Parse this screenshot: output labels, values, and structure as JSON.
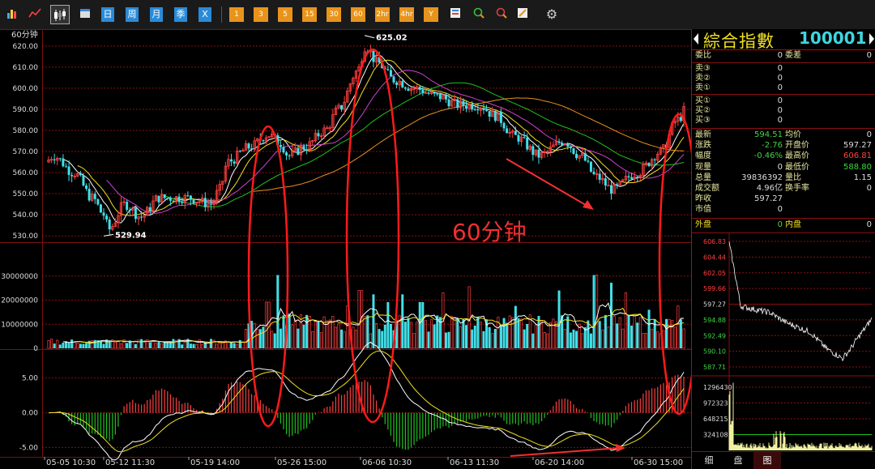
{
  "toolbar": {
    "blue_buttons": [
      {
        "label": "日",
        "name": "day-button"
      },
      {
        "label": "周",
        "name": "week-button"
      },
      {
        "label": "月",
        "name": "month-button"
      },
      {
        "label": "季",
        "name": "quarter-button"
      },
      {
        "label": "X",
        "name": "custom-period-button"
      }
    ],
    "orange_buttons": [
      {
        "label": "1",
        "name": "period-1-button"
      },
      {
        "label": "3",
        "name": "period-3-button"
      },
      {
        "label": "5",
        "name": "period-5-button"
      },
      {
        "label": "15",
        "name": "period-15-button"
      },
      {
        "label": "30",
        "name": "period-30-button"
      },
      {
        "label": "60",
        "name": "period-60-button"
      },
      {
        "label": "2hr",
        "name": "period-2hr-button"
      },
      {
        "label": "4hr",
        "name": "period-4hr-button"
      },
      {
        "label": "Y",
        "name": "year-button"
      }
    ]
  },
  "colors": {
    "up": "#ff4040",
    "down": "#40e0e8",
    "ma1": "#ffffff",
    "ma2": "#f0e020",
    "ma3": "#d040d0",
    "ma4": "#20c020",
    "ma5": "#e89020",
    "grid": "#8a1010"
  },
  "main_chart": {
    "period_label": "60分钟",
    "y_ticks": [
      "620.00",
      "610.00",
      "600.00",
      "590.00",
      "580.00",
      "570.00",
      "560.00",
      "550.00",
      "540.00",
      "530.00"
    ],
    "high_label": "625.02",
    "low_label": "529.94",
    "annotation": "60分钟"
  },
  "volume_chart": {
    "y_ticks": [
      "30000000",
      "20000000",
      "10000000",
      "0"
    ]
  },
  "macd_chart": {
    "y_ticks": [
      "5.00",
      "0.00",
      "-5.00"
    ]
  },
  "x_ticks": [
    "05-05 10:30",
    "05-12 11:30",
    "05-19 14:00",
    "05-26 15:00",
    "06-06 10:30",
    "06-13 11:30",
    "06-20 14:00",
    "06-30 15:00"
  ],
  "side": {
    "title": "綜合指數",
    "code": "100001",
    "order": {
      "wb_label": "委比",
      "wb_val": "0",
      "wc_label": "委差",
      "wc_val": "0",
      "asks": [
        {
          "label": "卖③",
          "val": "0"
        },
        {
          "label": "卖②",
          "val": "0"
        },
        {
          "label": "卖①",
          "val": "0"
        }
      ],
      "bids": [
        {
          "label": "买①",
          "val": "0"
        },
        {
          "label": "买②",
          "val": "0"
        },
        {
          "label": "买③",
          "val": "0"
        }
      ]
    },
    "quote": [
      {
        "l1": "最新",
        "v1": "594.51",
        "l2": "均价",
        "v2": "0"
      },
      {
        "l1": "涨跌",
        "v1": "-2.76",
        "l2": "开盘价",
        "v2": "597.27"
      },
      {
        "l1": "幅度",
        "v1": "-0.46%",
        "l2": "最高价",
        "v2": "606.81"
      },
      {
        "l1": "现量",
        "v1": "0",
        "l2": "最低价",
        "v2": "588.80"
      },
      {
        "l1": "总量",
        "v1": "39836392",
        "l2": "量比",
        "v2": "1.15"
      },
      {
        "l1": "成交额",
        "v1": "4.96亿",
        "l2": "换手率",
        "v2": "0"
      },
      {
        "l1": "昨收",
        "v1": "597.27",
        "l2": "",
        "v2": ""
      },
      {
        "l1": "市值",
        "v1": "0",
        "l2": "",
        "v2": ""
      }
    ],
    "outer_label": "外盘",
    "outer_val": "0",
    "inner_label": "内盘",
    "inner_val": "0",
    "mini_price_ticks": [
      "606.83",
      "604.44",
      "602.05",
      "599.66",
      "597.27",
      "594.88",
      "592.49",
      "590.10",
      "587.71"
    ],
    "mini_vol_ticks": [
      "1296430",
      "972323",
      "648215",
      "324108"
    ],
    "tabs": [
      "细",
      "盘",
      "图"
    ]
  }
}
